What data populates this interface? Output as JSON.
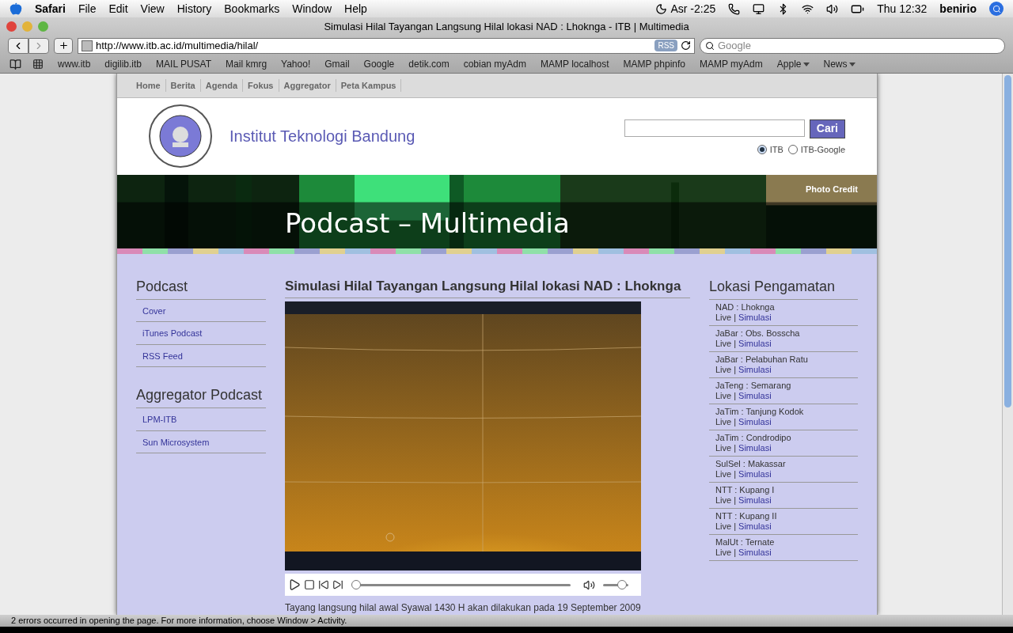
{
  "menubar": {
    "app": "Safari",
    "items": [
      "File",
      "Edit",
      "View",
      "History",
      "Bookmarks",
      "Window",
      "Help"
    ],
    "prayer": "Asr -2:25",
    "clock": "Thu 12:32",
    "user": "benirio"
  },
  "window": {
    "title": "Simulasi Hilal Tayangan Langsung Hilal lokasi NAD : Lhoknga - ITB | Multimedia"
  },
  "toolbar": {
    "url": "http://www.itb.ac.id/multimedia/hilal/",
    "rss": "RSS",
    "search_placeholder": "Google"
  },
  "bookmarks": [
    {
      "label": "www.itb",
      "menu": false
    },
    {
      "label": "digilib.itb",
      "menu": false
    },
    {
      "label": "MAIL PUSAT",
      "menu": false
    },
    {
      "label": "Mail kmrg",
      "menu": false
    },
    {
      "label": "Yahoo!",
      "menu": false
    },
    {
      "label": "Gmail",
      "menu": false
    },
    {
      "label": "Google",
      "menu": false
    },
    {
      "label": "detik.com",
      "menu": false
    },
    {
      "label": "cobian myAdm",
      "menu": false
    },
    {
      "label": "MAMP localhost",
      "menu": false
    },
    {
      "label": "MAMP phpinfo",
      "menu": false
    },
    {
      "label": "MAMP myAdm",
      "menu": false
    },
    {
      "label": "Apple",
      "menu": true
    },
    {
      "label": "News",
      "menu": true
    }
  ],
  "site": {
    "nav": [
      "Home",
      "Berita",
      "Agenda",
      "Fokus",
      "Aggregator",
      "Peta Kampus"
    ],
    "institution": "Institut Teknologi Bandung",
    "search_button": "Cari",
    "search_scope": [
      {
        "label": "ITB",
        "selected": true
      },
      {
        "label": "ITB-Google",
        "selected": false
      }
    ],
    "banner_title": "Podcast – Multimedia",
    "photo_credit": "Photo Credit",
    "left": [
      {
        "heading": "Podcast",
        "links": [
          "Cover",
          "iTunes Podcast",
          "RSS Feed"
        ]
      },
      {
        "heading": "Aggregator Podcast",
        "links": [
          "LPM-ITB",
          "Sun Microsystem"
        ]
      }
    ],
    "article": {
      "title": "Simulasi Hilal Tayangan Langsung Hilal lokasi NAD : Lhoknga",
      "player": {
        "position": {
          "level": 0.0
        },
        "volume": {
          "level": 0.75
        }
      },
      "text": "Tayang langsung hilal awal Syawal 1430 H akan dilakukan pada 19 September 2009"
    },
    "right": {
      "heading": "Lokasi Pengamatan",
      "locations": [
        {
          "name": "NAD : Lhoknga",
          "live": "Live",
          "separator": "|",
          "link": "Simulasi"
        },
        {
          "name": "JaBar : Obs. Bosscha",
          "live": "Live",
          "separator": "|",
          "link": "Simulasi"
        },
        {
          "name": "JaBar : Pelabuhan Ratu",
          "live": "Live",
          "separator": "|",
          "link": "Simulasi"
        },
        {
          "name": "JaTeng : Semarang",
          "live": "Live",
          "separator": "|",
          "link": "Simulasi"
        },
        {
          "name": "JaTim : Tanjung Kodok",
          "live": "Live",
          "separator": "|",
          "link": "Simulasi"
        },
        {
          "name": "JaTim : Condrodipo",
          "live": "Live",
          "separator": "|",
          "link": "Simulasi"
        },
        {
          "name": "SulSel : Makassar",
          "live": "Live",
          "separator": "|",
          "link": "Simulasi"
        },
        {
          "name": "NTT : Kupang I",
          "live": "Live",
          "separator": "|",
          "link": "Simulasi"
        },
        {
          "name": "NTT : Kupang II",
          "live": "Live",
          "separator": "|",
          "link": "Simulasi"
        },
        {
          "name": "MalUt : Ternate",
          "live": "Live",
          "separator": "|",
          "link": "Simulasi"
        }
      ]
    }
  },
  "status_bar": "2 errors occurred in opening the page. For more information, choose Window > Activity."
}
